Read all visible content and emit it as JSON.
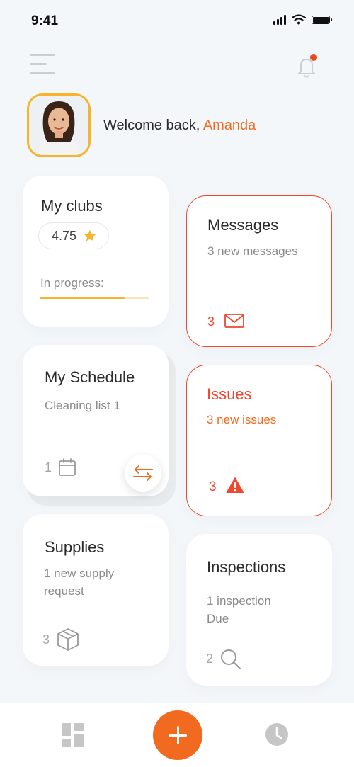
{
  "status_bar": {
    "time": "9:41"
  },
  "header": {
    "notification_unread": true
  },
  "welcome": {
    "greeting": "Welcome back,",
    "name": "Amanda"
  },
  "cards": {
    "clubs": {
      "title": "My clubs",
      "rating": "4.75",
      "progress_label": "In progress:",
      "progress": 0.78
    },
    "messages": {
      "title": "Messages",
      "subtitle": "3 new messages",
      "count": "3"
    },
    "schedule": {
      "title": "My Schedule",
      "subtitle": "Cleaning list 1",
      "count": "1"
    },
    "issues": {
      "title": "Issues",
      "subtitle": "3 new issues",
      "count": "3"
    },
    "supplies": {
      "title": "Supplies",
      "subtitle": "1 new supply request",
      "count": "3"
    },
    "inspections": {
      "title": "Inspections",
      "subtitle": "1 inspection Due",
      "count": "2"
    }
  },
  "colors": {
    "accent": "#f26a1f",
    "alert": "#f0472f",
    "star": "#f6b32b",
    "background": "#f4f7fa"
  },
  "icons": {
    "menu": "menu-icon",
    "bell": "bell-icon",
    "star": "star-icon",
    "mail": "mail-icon",
    "calendar": "calendar-icon",
    "swap": "swap-arrows-icon",
    "warning": "warning-icon",
    "box": "box-icon",
    "search": "search-icon",
    "dashboard": "dashboard-icon",
    "add": "plus-icon",
    "history": "clock-icon"
  }
}
